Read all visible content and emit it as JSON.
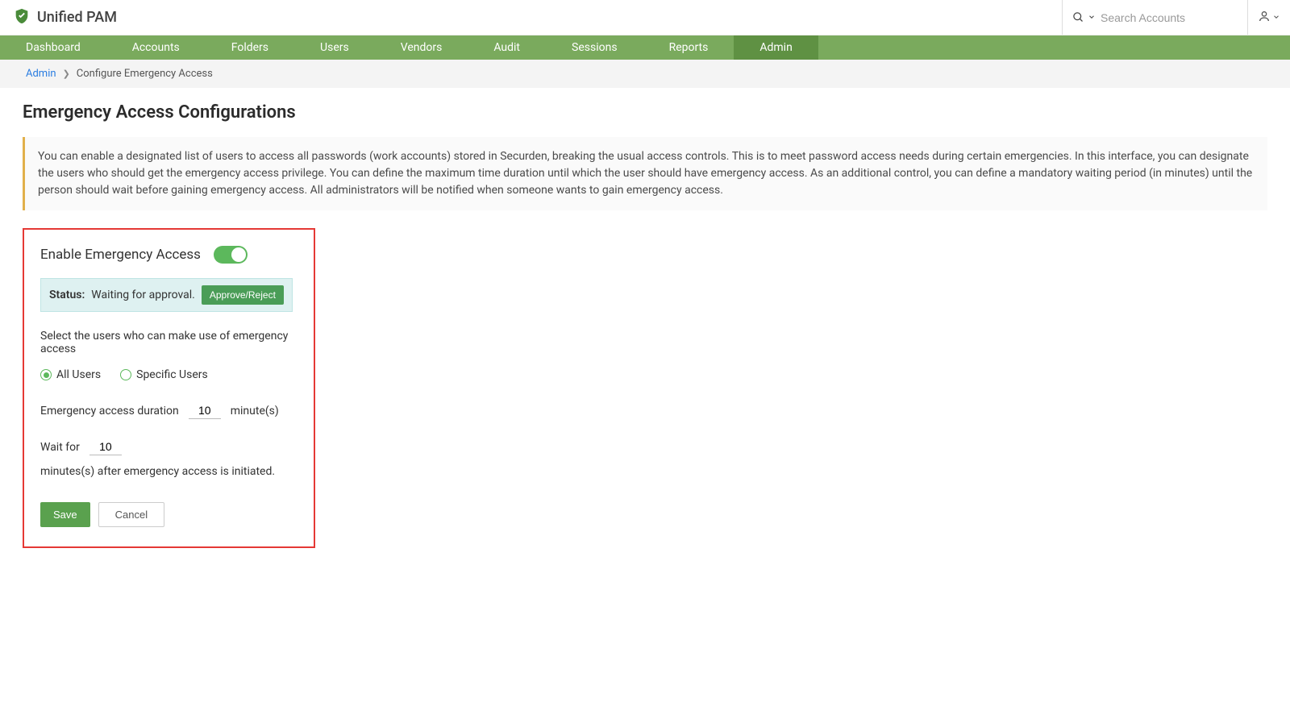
{
  "brand": {
    "title": "Unified PAM"
  },
  "header": {
    "search_placeholder": "Search Accounts"
  },
  "nav": {
    "items": [
      {
        "label": "Dashboard"
      },
      {
        "label": "Accounts"
      },
      {
        "label": "Folders"
      },
      {
        "label": "Users"
      },
      {
        "label": "Vendors"
      },
      {
        "label": "Audit"
      },
      {
        "label": "Sessions"
      },
      {
        "label": "Reports"
      },
      {
        "label": "Admin",
        "active": true
      }
    ]
  },
  "breadcrumb": {
    "root": "Admin",
    "current": "Configure Emergency Access"
  },
  "page": {
    "title": "Emergency Access Configurations",
    "info": "You can enable a designated list of users to access all passwords (work accounts) stored in Securden, breaking the usual access controls. This is to meet password access needs during certain emergencies. In this interface, you can designate the users who should get the emergency access privilege. You can define the maximum time duration until which the user should have emergency access. As an additional control, you can define a mandatory waiting period (in minutes) until the person should wait before gaining emergency access. All administrators will be notified when someone wants to gain emergency access."
  },
  "form": {
    "enable_label": "Enable Emergency Access",
    "enabled": true,
    "status_label": "Status:",
    "status_value": "Waiting for approval.",
    "approve_reject_label": "Approve/Reject",
    "select_users_label": "Select the users who can make use of emergency access",
    "radio_all": "All Users",
    "radio_specific": "Specific Users",
    "selected_radio": "all",
    "duration_label": "Emergency access duration",
    "duration_value": "10",
    "duration_unit": "minute(s)",
    "wait_prefix": "Wait for",
    "wait_value": "10",
    "wait_suffix": "minutes(s) after emergency access is initiated.",
    "save_label": "Save",
    "cancel_label": "Cancel"
  }
}
